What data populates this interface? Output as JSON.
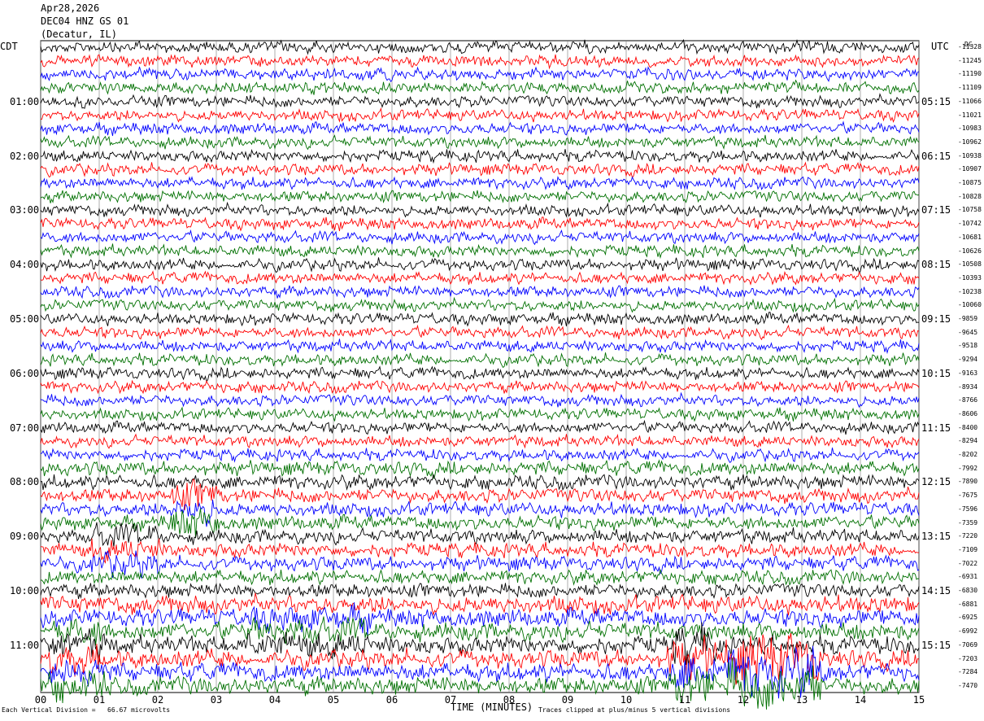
{
  "header": {
    "date": "Apr28,2026",
    "station": "DEC04 HNZ GS 01",
    "location": "(Decatur, IL)"
  },
  "left_axis_label": "CDT",
  "right_axis_label": "UTC",
  "corner_label": "DC",
  "x_axis_title": "TIME (MINUTES)",
  "footer": {
    "scale_note": "Each Vertical Division =   66.67 microvolts",
    "clip_note": "Traces clipped at plus/minus 5 vertical divisions"
  },
  "chart_data": {
    "type": "line",
    "title": "DEC04 HNZ GS 01",
    "xlabel": "TIME (MINUTES)",
    "xlim": [
      0,
      15
    ],
    "x_ticks": [
      "00",
      "01",
      "02",
      "03",
      "04",
      "05",
      "06",
      "07",
      "08",
      "09",
      "10",
      "11",
      "12",
      "13",
      "14",
      "15"
    ],
    "trace_count": 48,
    "trace_interval_minutes": 15,
    "trace_colors": [
      "#000000",
      "#ff0000",
      "#0000ff",
      "#007000"
    ],
    "left_time_labels": [
      "01:00",
      "02:00",
      "03:00",
      "04:00",
      "05:00",
      "06:00",
      "07:00",
      "08:00",
      "09:00",
      "10:00",
      "11:00"
    ],
    "right_time_labels": [
      "05:15",
      "06:15",
      "07:15",
      "08:15",
      "09:15",
      "10:15",
      "11:15",
      "12:15",
      "13:15",
      "14:15",
      "15:15"
    ],
    "trace_offsets": [
      "-11328",
      "-11245",
      "-11190",
      "-11109",
      "-11066",
      "-11021",
      "-10983",
      "-10962",
      "-10938",
      "-10907",
      "-10875",
      "-10828",
      "-10758",
      "-10742",
      "-10681",
      "-10626",
      "-10508",
      "-10393",
      "-10238",
      "-10060",
      "-9859",
      "-9645",
      "-9518",
      "-9294",
      "-9163",
      "-8934",
      "-8766",
      "-8606",
      "-8400",
      "-8294",
      "-8202",
      "-7992",
      "-7890",
      "-7675",
      "-7596",
      "-7359",
      "-7220",
      "-7109",
      "-7022",
      "-6931",
      "-6830",
      "-6881",
      "-6925",
      "-6992",
      "-7069",
      "-7203",
      "-7284",
      "-7470"
    ]
  }
}
